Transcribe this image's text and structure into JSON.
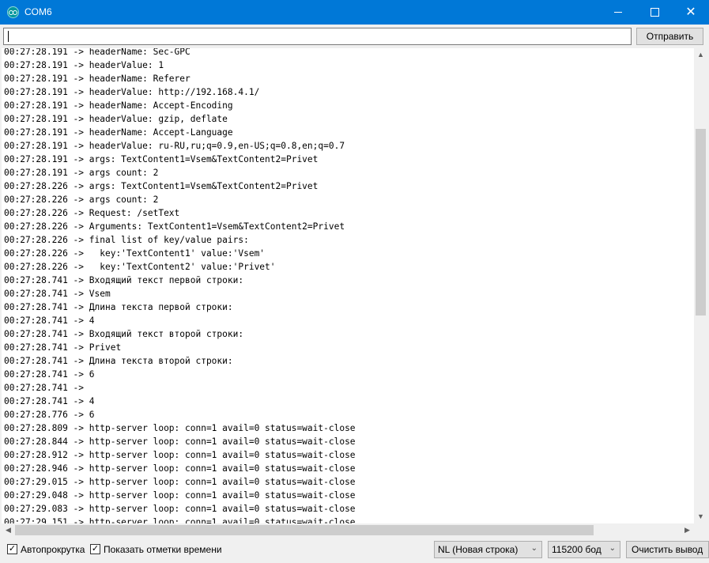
{
  "window": {
    "title": "COM6",
    "app_icon": "arduino-icon",
    "controls": {
      "minimize": "minimize-icon",
      "maximize": "maximize-icon",
      "close": "close-icon",
      "close_glyph": "✕"
    },
    "accent_color": "#0078d7"
  },
  "send": {
    "input_value": "",
    "button_label": "Отправить"
  },
  "output_lines": [
    "00:27:28.191 -> headerName: Sec-GPC",
    "00:27:28.191 -> headerValue: 1",
    "00:27:28.191 -> headerName: Referer",
    "00:27:28.191 -> headerValue: http://192.168.4.1/",
    "00:27:28.191 -> headerName: Accept-Encoding",
    "00:27:28.191 -> headerValue: gzip, deflate",
    "00:27:28.191 -> headerName: Accept-Language",
    "00:27:28.191 -> headerValue: ru-RU,ru;q=0.9,en-US;q=0.8,en;q=0.7",
    "00:27:28.191 -> args: TextContent1=Vsem&TextContent2=Privet",
    "00:27:28.191 -> args count: 2",
    "00:27:28.226 -> args: TextContent1=Vsem&TextContent2=Privet",
    "00:27:28.226 -> args count: 2",
    "00:27:28.226 -> Request: /setText",
    "00:27:28.226 -> Arguments: TextContent1=Vsem&TextContent2=Privet",
    "00:27:28.226 -> final list of key/value pairs:",
    "00:27:28.226 ->   key:'TextContent1' value:'Vsem'",
    "00:27:28.226 ->   key:'TextContent2' value:'Privet'",
    "00:27:28.741 -> Входящий текст первой строки:",
    "00:27:28.741 -> Vsem",
    "00:27:28.741 -> Длина текста первой строки:",
    "00:27:28.741 -> 4",
    "00:27:28.741 -> Входящий текст второй строки:",
    "00:27:28.741 -> Privet",
    "00:27:28.741 -> Длина текста второй строки:",
    "00:27:28.741 -> 6",
    "00:27:28.741 -> ",
    "00:27:28.741 -> 4",
    "00:27:28.776 -> 6",
    "00:27:28.809 -> http-server loop: conn=1 avail=0 status=wait-close",
    "00:27:28.844 -> http-server loop: conn=1 avail=0 status=wait-close",
    "00:27:28.912 -> http-server loop: conn=1 avail=0 status=wait-close",
    "00:27:28.946 -> http-server loop: conn=1 avail=0 status=wait-close",
    "00:27:29.015 -> http-server loop: conn=1 avail=0 status=wait-close",
    "00:27:29.048 -> http-server loop: conn=1 avail=0 status=wait-close",
    "00:27:29.083 -> http-server loop: conn=1 avail=0 status=wait-close",
    "00:27:29.151 -> http-server loop: conn=1 avail=0 status=wait-close"
  ],
  "scrollbars": {
    "up_glyph": "▲",
    "down_glyph": "▼",
    "left_glyph": "◀",
    "right_glyph": "▶"
  },
  "status": {
    "autoscroll": {
      "label": "Автопрокрутка",
      "checked": true,
      "mark": "✓"
    },
    "timestamps": {
      "label": "Показать отметки времени",
      "checked": true,
      "mark": "✓"
    },
    "line_ending": "NL (Новая строка)",
    "baud_rate": "115200 бод",
    "dropdown_glyph": "⌄",
    "clear_label": "Очистить вывод"
  }
}
